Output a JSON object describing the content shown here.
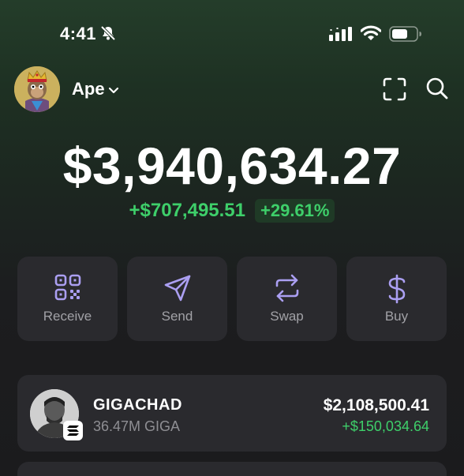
{
  "status_bar": {
    "time": "4:41",
    "icons": [
      "bell-slash-icon",
      "signal-icon",
      "wifi-icon",
      "battery-icon"
    ]
  },
  "header": {
    "account_name": "Ape",
    "avatar": "bored-ape-avatar",
    "icons": [
      "chevron-down-icon",
      "scan-icon",
      "search-icon"
    ]
  },
  "portfolio": {
    "balance": "$3,940,634.27",
    "change_amount": "+$707,495.51",
    "change_percent": "+29.61%",
    "positive_color": "#3ecf6a"
  },
  "actions": [
    {
      "label": "Receive",
      "icon": "qr-code-icon"
    },
    {
      "label": "Send",
      "icon": "send-icon"
    },
    {
      "label": "Swap",
      "icon": "swap-icon"
    },
    {
      "label": "Buy",
      "icon": "dollar-icon"
    }
  ],
  "tokens": [
    {
      "name": "GIGACHAD",
      "quantity": "36.47M GIGA",
      "value": "$2,108,500.41",
      "change": "+$150,034.64",
      "chain_badge": "solana-icon"
    }
  ],
  "colors": {
    "accent_purple": "#ab9ff2",
    "card_bg": "#2a2a2e",
    "muted_text": "#a1a1a6"
  }
}
